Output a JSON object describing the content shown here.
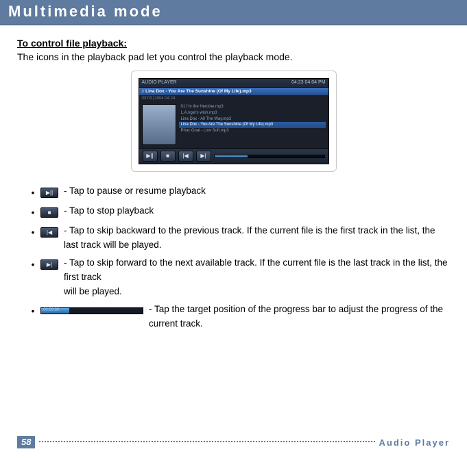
{
  "header": {
    "title": "Multimedia mode"
  },
  "section": {
    "subhead": "To control file playback:",
    "intro": "The icons in the playback pad let you control the playback mode."
  },
  "player": {
    "title_left": "AUDIO PLAYER",
    "title_right": "04:23   04:04 PM",
    "now_playing": "♫ Lina Dox - You Are The Sunshine (Of My Life).mp3",
    "meta": "03:03│2004.04.24",
    "tracks": {
      "t1": "01 I'm the Heroine.mp3",
      "t2": "L.A.ngel's wish.mp3",
      "t3": "Lina Dox - All The Way.mp3",
      "t4": "Lina Dox - You Are The Sunshine (Of My Life).mp3",
      "t5": "Phuc Goal - Low Soft.mp3"
    }
  },
  "bullets": {
    "b1": "- Tap to pause or resume playback",
    "b2": "- Tap to stop playback",
    "b3": "- Tap to skip backward to the previous track. If the current file is the first track in the list, the last track will be played.",
    "b4a": "- Tap to skip forward to the next available track. If the current file is the last track in the list, the first track",
    "b4b": "will be played.",
    "b5": "- Tap the target position of the progress bar to adjust the progress of the current track.",
    "progress_text": "00:00:30"
  },
  "footer": {
    "page": "58",
    "label": "Audio Player"
  }
}
